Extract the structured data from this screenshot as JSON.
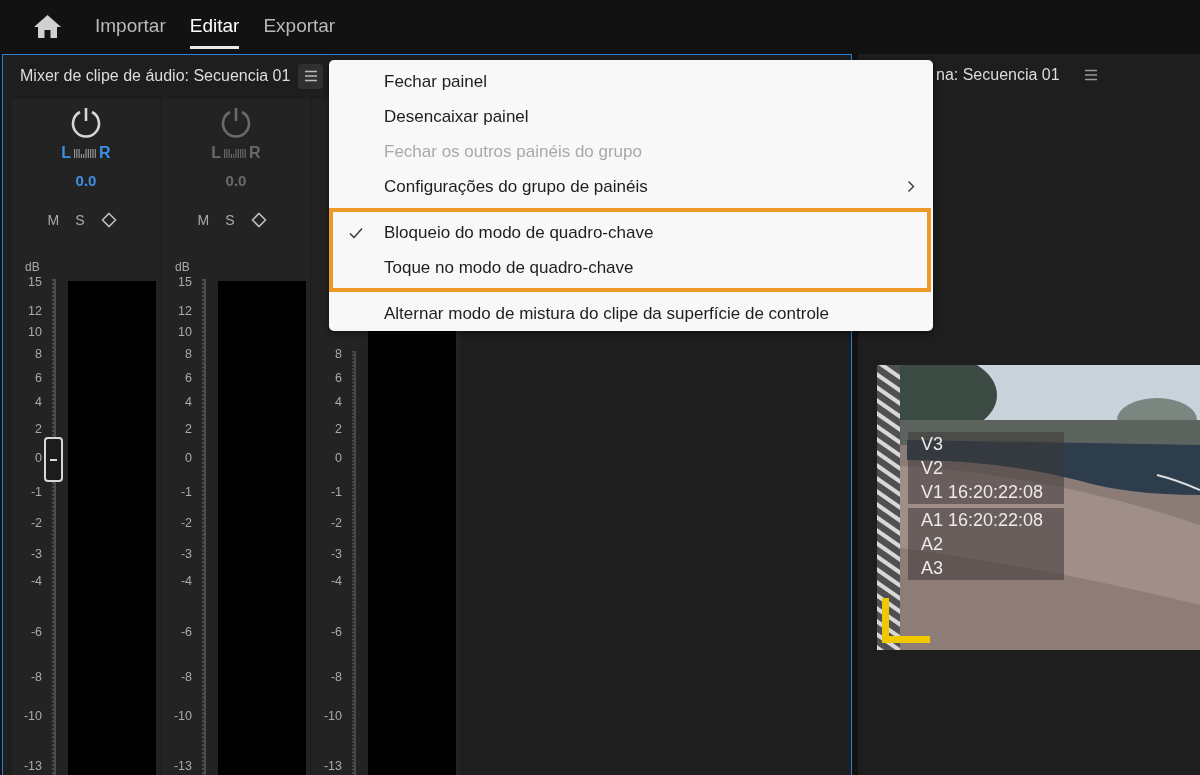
{
  "top_nav": {
    "tabs": [
      {
        "label": "Importar",
        "selected": false
      },
      {
        "label": "Editar",
        "selected": true
      },
      {
        "label": "Exportar",
        "selected": false
      }
    ]
  },
  "mixer_panel": {
    "title": "Mixer de clipe de áudio: Secuencia 01",
    "active": true,
    "strips": [
      {
        "selected": true,
        "pan_left": "L",
        "pan_right": "R",
        "value": "0.0",
        "mute": "M",
        "solo": "S",
        "unit": "dB",
        "scale": [
          "15",
          "12",
          "10",
          "8",
          "6",
          "4",
          "2",
          "0",
          "-1",
          "-2",
          "-3",
          "-4",
          "-6",
          "-8",
          "-10",
          "-13"
        ]
      },
      {
        "selected": false,
        "pan_left": "L",
        "pan_right": "R",
        "value": "0.0",
        "mute": "M",
        "solo": "S",
        "unit": "dB",
        "scale": [
          "15",
          "12",
          "10",
          "8",
          "6",
          "4",
          "2",
          "0",
          "-1",
          "-2",
          "-3",
          "-4",
          "-6",
          "-8",
          "-10",
          "-13"
        ]
      },
      {
        "selected": false,
        "scale": [
          "8",
          "6",
          "4",
          "2",
          "0",
          "-1",
          "-2",
          "-3",
          "-4",
          "-6",
          "-8",
          "-10",
          "-13"
        ]
      }
    ]
  },
  "program_panel": {
    "title": "na: Secuencia 01",
    "overlay": {
      "video_tracks": [
        "V3",
        "V2",
        "V1 16:20:22:08"
      ],
      "audio_tracks": [
        "A1 16:20:22:08",
        "A2",
        "A3"
      ]
    }
  },
  "panel_menu": {
    "sections": [
      {
        "highlighted": false,
        "items": [
          {
            "kind": "command",
            "label": "Fechar painel",
            "disabled": false,
            "checked": false
          },
          {
            "kind": "command",
            "label": "Desencaixar painel",
            "disabled": false,
            "checked": false
          },
          {
            "kind": "command",
            "label": "Fechar os outros painéis do grupo",
            "disabled": true,
            "checked": false
          },
          {
            "kind": "submenu",
            "label": "Configurações do grupo de painéis",
            "disabled": false,
            "checked": false
          }
        ]
      },
      {
        "highlighted": true,
        "items": [
          {
            "kind": "command",
            "label": "Bloqueio do modo de quadro-chave",
            "disabled": false,
            "checked": true
          },
          {
            "kind": "command",
            "label": "Toque no modo de quadro-chave",
            "disabled": false,
            "checked": false
          }
        ]
      },
      {
        "highlighted": false,
        "items": [
          {
            "kind": "command",
            "label": "Alternar modo de mistura do clipe da superfície de controle",
            "disabled": false,
            "checked": false
          }
        ]
      }
    ]
  }
}
